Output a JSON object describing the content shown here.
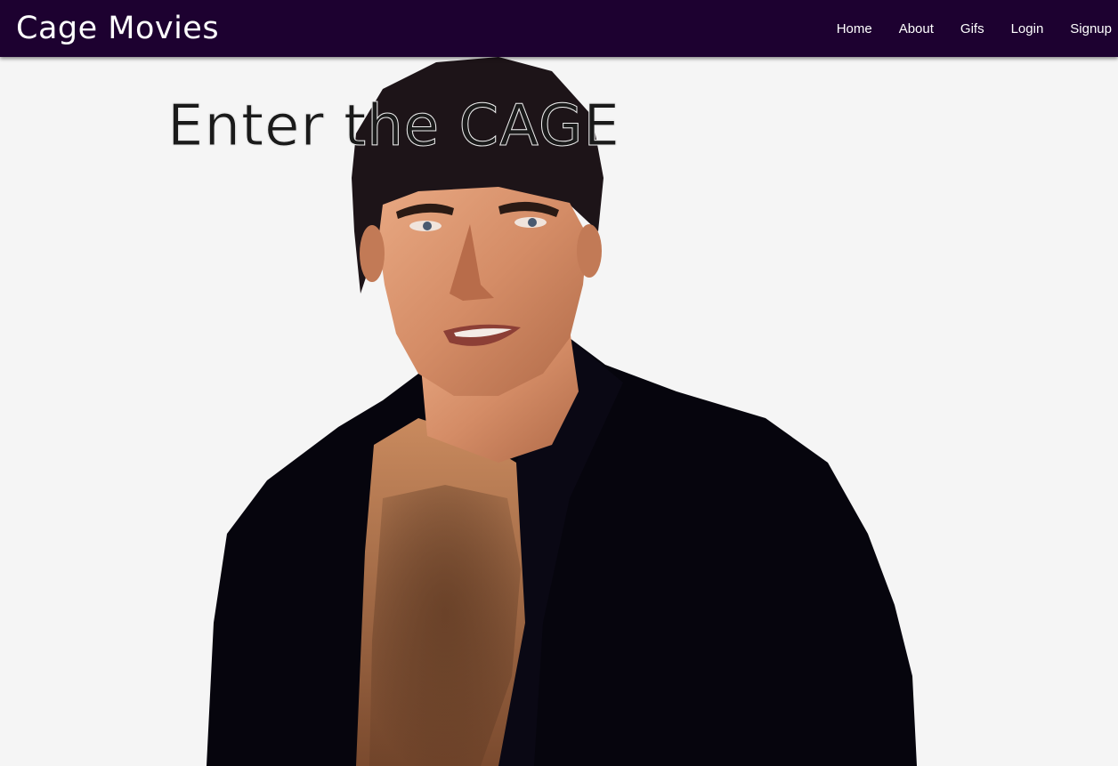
{
  "navbar": {
    "brand": "Cage Movies",
    "links": [
      {
        "label": "Home"
      },
      {
        "label": "About"
      },
      {
        "label": "Gifs"
      },
      {
        "label": "Login"
      },
      {
        "label": "Signup"
      }
    ]
  },
  "hero": {
    "title": "Enter the CAGE",
    "image_subject": "portrait of a man in an open black shirt"
  },
  "colors": {
    "navbar_bg": "#1d0130",
    "page_bg": "#f5f5f5",
    "nav_text": "#ffffff",
    "title_text": "#1a1a1a",
    "shirt": "#06050d"
  }
}
